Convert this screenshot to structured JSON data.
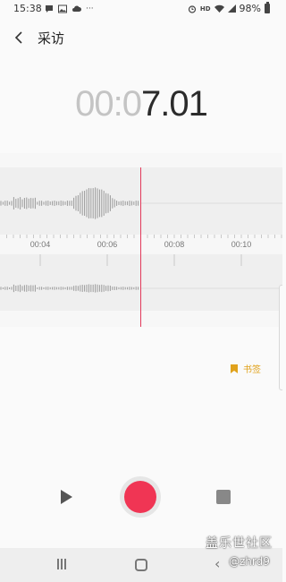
{
  "status_bar": {
    "time": "15:38",
    "battery": "98%",
    "hd_label": "HD",
    "more": "···"
  },
  "header": {
    "title": "采访"
  },
  "timer": {
    "dim_part": "00:0",
    "bright_part": "7.01"
  },
  "timeline": {
    "ticks": [
      "00:04",
      "00:06",
      "00:08",
      "00:10"
    ]
  },
  "bookmark": {
    "label": "书签"
  },
  "watermark": {
    "line1": "盖乐世社区",
    "line2": "@zhrd9"
  },
  "colors": {
    "record": "#f03554",
    "playhead": "#e2395a",
    "bookmark": "#e0a21c"
  }
}
